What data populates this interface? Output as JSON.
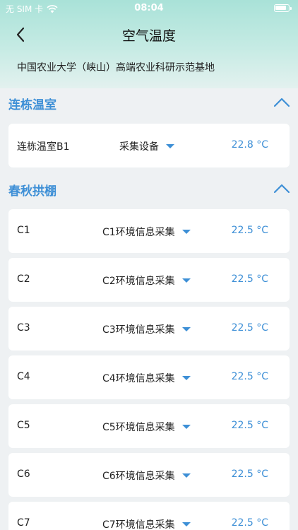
{
  "status": {
    "carrier": "无 SIM 卡",
    "time": "08:04"
  },
  "nav": {
    "title": "空气温度"
  },
  "base_name": "中国农业大学（峡山）高端农业科研示范基地",
  "sections": [
    {
      "title": "连栋温室",
      "rows": [
        {
          "name": "连栋温室B1",
          "device": "采集设备",
          "value": "22.8 °C"
        }
      ]
    },
    {
      "title": "春秋拱棚",
      "rows": [
        {
          "name": "C1",
          "device": "C1环境信息采集",
          "value": "22.5 °C"
        },
        {
          "name": "C2",
          "device": "C2环境信息采集",
          "value": "22.5 °C"
        },
        {
          "name": "C3",
          "device": "C3环境信息采集",
          "value": "22.5 °C"
        },
        {
          "name": "C4",
          "device": "C4环境信息采集",
          "value": "22.5 °C"
        },
        {
          "name": "C5",
          "device": "C5环境信息采集",
          "value": "22.5 °C"
        },
        {
          "name": "C6",
          "device": "C6环境信息采集",
          "value": "22.5 °C"
        },
        {
          "name": "C7",
          "device": "C7环境信息采集",
          "value": "22.5 °C"
        }
      ]
    }
  ],
  "colors": {
    "accent": "#3d8fd6",
    "header_top": "#a9e2d8",
    "background": "#eef1f3"
  },
  "icons": {
    "back": "chevron-left-icon",
    "collapse": "chevron-up-icon",
    "dropdown": "caret-down-icon"
  }
}
